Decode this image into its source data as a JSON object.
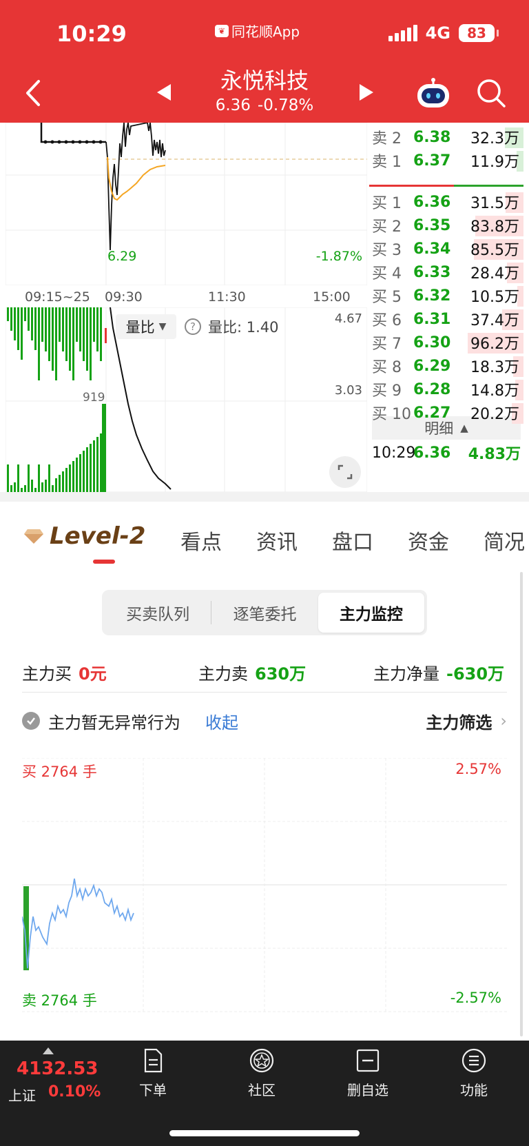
{
  "status": {
    "time": "10:29",
    "app_source": "同花顺App",
    "network": "4G",
    "battery": "83"
  },
  "header": {
    "title": "永悦科技",
    "price": "6.36",
    "change_pct": "-0.78%"
  },
  "chart": {
    "low_label": "6.29",
    "low_pct": "-1.87%",
    "time_labels": [
      "09:15~25",
      "09:30",
      "11:30",
      "15:00"
    ],
    "vol_high": "4.67",
    "vol_mid": "3.03",
    "vol_marker": "919",
    "vol_selector": "量比",
    "vol_ratio_label": "量比: 1.40",
    "colors": {
      "up": "#e63535",
      "down": "#15a215",
      "avg": "#f5a623"
    }
  },
  "order_book": {
    "sells": [
      {
        "label": "卖 2",
        "price": "6.38",
        "vol": "32.3万"
      },
      {
        "label": "卖 1",
        "price": "6.37",
        "vol": "11.9万"
      }
    ],
    "buys": [
      {
        "label": "买 1",
        "price": "6.36",
        "vol": "31.5万"
      },
      {
        "label": "买 2",
        "price": "6.35",
        "vol": "83.8万"
      },
      {
        "label": "买 3",
        "price": "6.34",
        "vol": "85.5万"
      },
      {
        "label": "买 4",
        "price": "6.33",
        "vol": "28.4万"
      },
      {
        "label": "买 5",
        "price": "6.32",
        "vol": "10.5万"
      },
      {
        "label": "买 6",
        "price": "6.31",
        "vol": "37.4万"
      },
      {
        "label": "买 7",
        "price": "6.30",
        "vol": "96.2万"
      },
      {
        "label": "买 8",
        "price": "6.29",
        "vol": "18.3万"
      },
      {
        "label": "买 9",
        "price": "6.28",
        "vol": "14.8万"
      },
      {
        "label": "买 10",
        "price": "6.27",
        "vol": "20.2万"
      }
    ],
    "detail_label": "明细",
    "last_trade": {
      "time": "10:29",
      "price": "6.36",
      "vol": "4.83万"
    }
  },
  "tabs": {
    "level2": "Level-2",
    "items": [
      "看点",
      "资讯",
      "盘口",
      "资金",
      "简况"
    ]
  },
  "segments": [
    "买卖队列",
    "逐笔委托",
    "主力监控"
  ],
  "summary": {
    "buy_label": "主力买",
    "buy_value": "0元",
    "sell_label": "主力卖",
    "sell_value": "630万",
    "net_label": "主力净量",
    "net_value": "-630万"
  },
  "abnormal": {
    "text": "主力暂无异常行为",
    "collapse": "收起",
    "filter": "主力筛选"
  },
  "monitor": {
    "buy_label": "买 2764 手",
    "sell_label": "卖 2764 手",
    "top_pct": "2.57%",
    "bottom_pct": "-2.57%"
  },
  "index": {
    "value": "4132.53",
    "name": "上证",
    "pct": "0.10%"
  },
  "bottom_nav": [
    "下单",
    "社区",
    "删自选",
    "功能"
  ]
}
